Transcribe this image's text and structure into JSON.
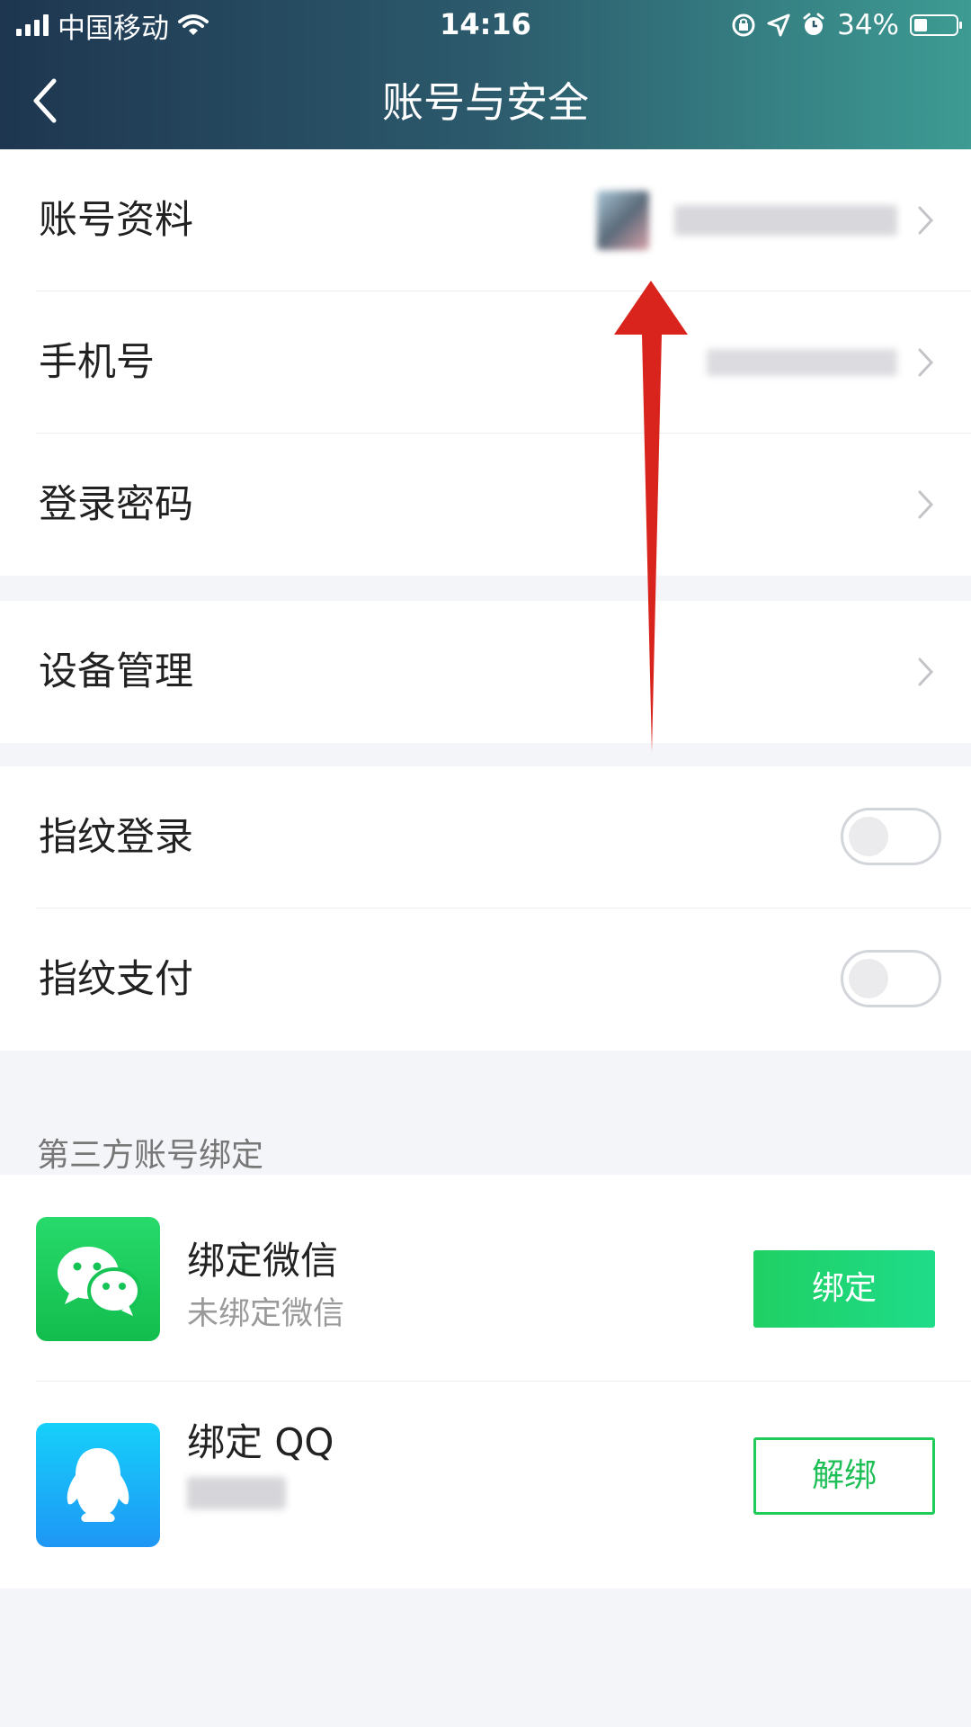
{
  "status_bar": {
    "carrier": "中国移动",
    "time": "14:16",
    "battery": "34%",
    "battery_level": 0.34,
    "icons": [
      "signal-icon",
      "wifi-icon",
      "rotation-lock-icon",
      "location-icon",
      "alarm-icon",
      "battery-icon"
    ]
  },
  "nav": {
    "title": "账号与安全",
    "back_icon": "chevron-left-icon"
  },
  "items": {
    "account": {
      "label": "账号资料"
    },
    "phone": {
      "label": "手机号"
    },
    "password": {
      "label": "登录密码"
    },
    "device": {
      "label": "设备管理"
    },
    "fingerprint_login": {
      "label": "指纹登录",
      "enabled": false
    },
    "fingerprint_pay": {
      "label": "指纹支付",
      "enabled": false
    }
  },
  "third_party": {
    "section_title": "第三方账号绑定",
    "wechat": {
      "title": "绑定微信",
      "subtitle": "未绑定微信",
      "button": "绑定",
      "icon": "wechat-icon"
    },
    "qq": {
      "title": "绑定 QQ",
      "button": "解绑",
      "icon": "qq-icon"
    }
  },
  "colors": {
    "accent_green": "#1fcc5a",
    "annotation_arrow": "#d9241d",
    "header_start": "#1e3650",
    "header_end": "#3d9b93"
  }
}
